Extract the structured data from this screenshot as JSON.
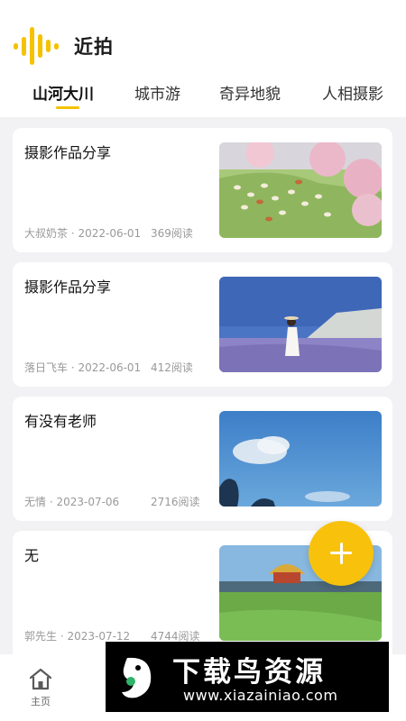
{
  "app": {
    "title": "近拍",
    "icon": "sound-wave-logo-icon"
  },
  "tabs": [
    {
      "label": "山河大川",
      "active": true
    },
    {
      "label": "城市游",
      "active": false
    },
    {
      "label": "奇异地貌",
      "active": false
    },
    {
      "label": "人相摄影",
      "active": false
    }
  ],
  "posts": [
    {
      "title": "摄影作品分享",
      "meta": "大叔奶茶 · 2022-06-01",
      "reads": "369阅读",
      "image": "sheep-grazing-under-blossom-trees"
    },
    {
      "title": "摄影作品分享",
      "meta": "落日飞车 · 2022-06-01",
      "reads": "412阅读",
      "image": "woman-in-lavender-field-by-lake"
    },
    {
      "title": "有没有老师",
      "meta": "无情 · 2023-07-06",
      "reads": "2716阅读",
      "image": "blue-sky-with-clouds"
    },
    {
      "title": "无",
      "meta": "郭先生 · 2023-07-12",
      "reads": "4744阅读",
      "image": "grassland-with-golden-roof-building"
    }
  ],
  "fab": {
    "icon": "plus-icon"
  },
  "bottom_nav": {
    "home_label": "主页",
    "home_icon": "home-icon"
  },
  "watermark": {
    "title": "下载鸟资源",
    "url": "www.xiazainiao.com"
  },
  "colors": {
    "accent": "#f8c20c",
    "background": "#f2f2f4",
    "card": "#ffffff",
    "meta_text": "#999999"
  }
}
